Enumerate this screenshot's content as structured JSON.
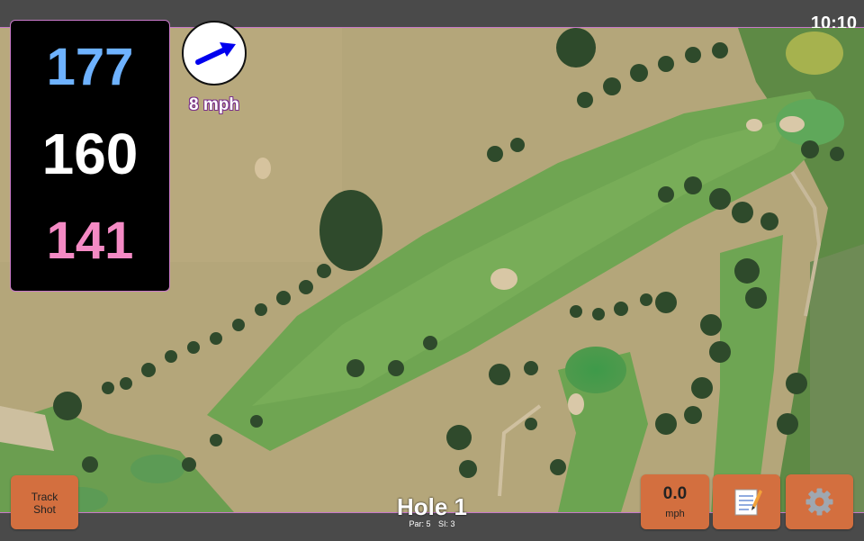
{
  "status": {
    "time": "10:10"
  },
  "distances": {
    "back": "177",
    "middle": "160",
    "front": "141"
  },
  "wind": {
    "speed": "8 mph",
    "icon": "wind-direction-arrow-icon"
  },
  "hole": {
    "title": "Hole 1",
    "par": "Par: 5",
    "si": "SI: 3"
  },
  "buttons": {
    "track_shot_line1": "Track",
    "track_shot_line2": "Shot",
    "speed_value": "0.0",
    "speed_unit": "mph",
    "notes_icon": "memo-icon",
    "settings_icon": "gear-icon"
  },
  "colors": {
    "back": "#6eb2ff",
    "middle": "#ffffff",
    "front": "#f48ac4",
    "button": "#d36f3f",
    "accent_border": "#c879c9"
  }
}
